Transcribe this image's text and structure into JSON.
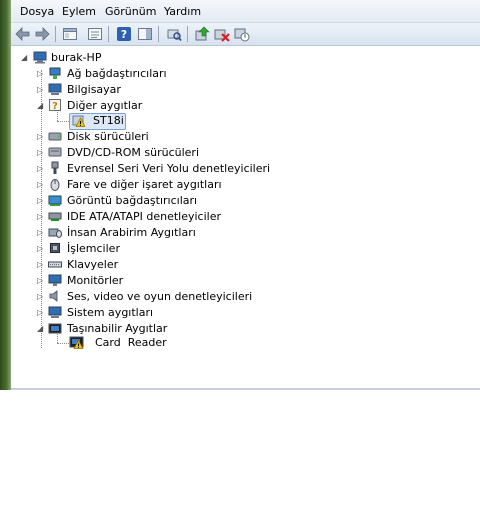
{
  "menu": {
    "items": [
      {
        "label": "Dosya"
      },
      {
        "label": "Eylem"
      },
      {
        "label": "Görünüm"
      },
      {
        "label": "Yardım"
      }
    ]
  },
  "toolbar": {
    "buttons": [
      {
        "icon": "back-arrow-icon"
      },
      {
        "icon": "forward-arrow-icon"
      },
      {
        "icon": "show-hide-console-tree-icon"
      },
      {
        "icon": "properties-icon"
      },
      {
        "icon": "help-icon"
      },
      {
        "icon": "show-action-pane-icon"
      },
      {
        "icon": "scan-hardware-changes-icon"
      },
      {
        "icon": "update-driver-icon"
      },
      {
        "icon": "uninstall-device-icon"
      },
      {
        "icon": "disable-device-icon"
      }
    ]
  },
  "tree": {
    "root": {
      "label": "burak-HP",
      "icon": "computer-icon"
    },
    "categories": [
      {
        "label": "Ağ bağdaştırıcıları",
        "icon": "network-adapter-icon",
        "expanded": false
      },
      {
        "label": "Bilgisayar",
        "icon": "computer-icon",
        "expanded": false
      },
      {
        "label": "Diğer aygıtlar",
        "icon": "unknown-device-icon",
        "expanded": true,
        "children": [
          {
            "label": "ST18i",
            "icon": "warning-device-icon",
            "selected": true
          }
        ]
      },
      {
        "label": "Disk sürücüleri",
        "icon": "disk-drive-icon",
        "expanded": false
      },
      {
        "label": "DVD/CD-ROM sürücüleri",
        "icon": "dvd-drive-icon",
        "expanded": false
      },
      {
        "label": "Evrensel Seri Veri Yolu denetleyicileri",
        "icon": "usb-controller-icon",
        "expanded": false
      },
      {
        "label": "Fare ve diğer işaret aygıtları",
        "icon": "mouse-icon",
        "expanded": false
      },
      {
        "label": "Görüntü bağdaştırıcıları",
        "icon": "display-adapter-icon",
        "expanded": false
      },
      {
        "label": "IDE ATA/ATAPI denetleyiciler",
        "icon": "ide-controller-icon",
        "expanded": false
      },
      {
        "label": "İnsan Arabirim Aygıtları",
        "icon": "hid-icon",
        "expanded": false
      },
      {
        "label": "İşlemciler",
        "icon": "processor-icon",
        "expanded": false
      },
      {
        "label": "Klavyeler",
        "icon": "keyboard-icon",
        "expanded": false
      },
      {
        "label": "Monitörler",
        "icon": "monitor-icon",
        "expanded": false
      },
      {
        "label": "Ses, video ve oyun denetleyicileri",
        "icon": "sound-icon",
        "expanded": false
      },
      {
        "label": "Sistem aygıtları",
        "icon": "system-device-icon",
        "expanded": false
      },
      {
        "label": "Taşınabilir Aygıtlar",
        "icon": "portable-device-icon",
        "expanded": true,
        "children": [
          {
            "label": "Card  Reader",
            "icon": "warning-device-icon",
            "selected": false
          }
        ]
      }
    ]
  },
  "colors": {
    "selection_bg": "#dde8f6",
    "selection_border": "#7da2ce",
    "warning": "#f2c200"
  }
}
